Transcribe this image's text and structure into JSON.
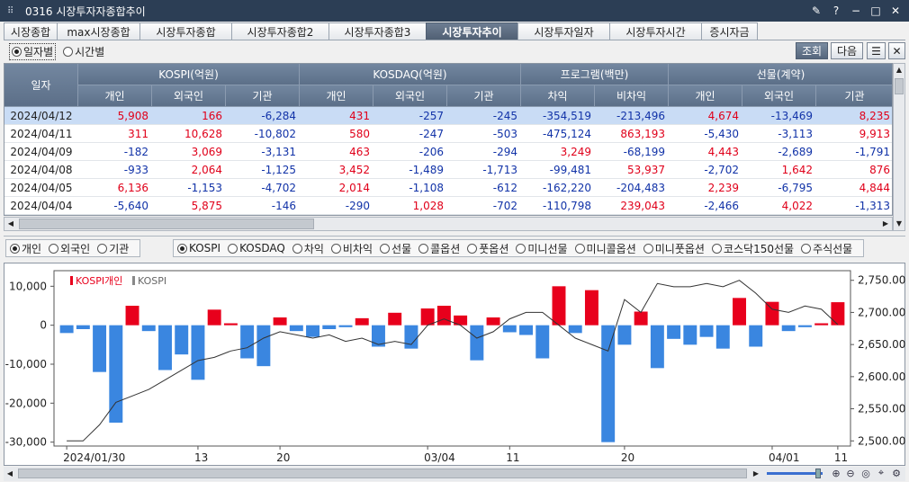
{
  "window": {
    "title": "0316 시장투자자종합추이"
  },
  "tabs": [
    "시장종합",
    "max시장종합",
    "시장투자종합",
    "시장투자종합2",
    "시장투자종합3",
    "시장투자추이",
    "시장투자일자",
    "시장투자시간",
    "증시자금"
  ],
  "active_tab": 5,
  "mode_options": {
    "by_date": "일자별",
    "by_time": "시간별"
  },
  "buttons": {
    "query": "조회",
    "next": "다음"
  },
  "table": {
    "date_header": "일자",
    "groups": [
      "KOSPI(억원)",
      "KOSDAQ(억원)",
      "프로그램(백만)",
      "선물(계약)"
    ],
    "subheaders": [
      "개인",
      "외국인",
      "기관",
      "개인",
      "외국인",
      "기관",
      "차익",
      "비차익",
      "개인",
      "외국인",
      "기관"
    ],
    "rows": [
      {
        "date": "2024/04/12",
        "vals": [
          "5,908",
          "166",
          "-6,284",
          "431",
          "-257",
          "-245",
          "-354,519",
          "-213,496",
          "4,674",
          "-13,469",
          "8,235"
        ]
      },
      {
        "date": "2024/04/11",
        "vals": [
          "311",
          "10,628",
          "-10,802",
          "580",
          "-247",
          "-503",
          "-475,124",
          "863,193",
          "-5,430",
          "-3,113",
          "9,913"
        ]
      },
      {
        "date": "2024/04/09",
        "vals": [
          "-182",
          "3,069",
          "-3,131",
          "463",
          "-206",
          "-294",
          "3,249",
          "-68,199",
          "4,443",
          "-2,689",
          "-1,791"
        ]
      },
      {
        "date": "2024/04/08",
        "vals": [
          "-933",
          "2,064",
          "-1,125",
          "3,452",
          "-1,489",
          "-1,713",
          "-99,481",
          "53,937",
          "-2,702",
          "1,642",
          "876"
        ]
      },
      {
        "date": "2024/04/05",
        "vals": [
          "6,136",
          "-1,153",
          "-4,702",
          "2,014",
          "-1,108",
          "-612",
          "-162,220",
          "-204,483",
          "2,239",
          "-6,795",
          "4,844"
        ]
      },
      {
        "date": "2024/04/04",
        "vals": [
          "-5,640",
          "5,875",
          "-146",
          "-290",
          "1,028",
          "-702",
          "-110,798",
          "239,043",
          "-2,466",
          "4,022",
          "-1,313"
        ]
      }
    ]
  },
  "investor_options": [
    "개인",
    "외국인",
    "기관"
  ],
  "market_options": [
    "KOSPI",
    "KOSDAQ",
    "차익",
    "비차익",
    "선물",
    "콜옵션",
    "풋옵션",
    "미니선물",
    "미니콜옵션",
    "미니풋옵션",
    "코스닥150선물",
    "주식선물"
  ],
  "chart_data": {
    "type": "bar",
    "legend": [
      "KOSPI개인",
      "KOSPI"
    ],
    "series": [
      {
        "name": "KOSPI개인",
        "values": [
          -2000,
          -1000,
          -12000,
          -25000,
          5000,
          -1500,
          -11500,
          -7500,
          -14000,
          4000,
          500,
          -8500,
          -10500,
          2000,
          -1500,
          -3000,
          -1000,
          -500,
          1800,
          -5500,
          3200,
          -6000,
          4300,
          5000,
          2500,
          -9000,
          2000,
          -1800,
          -2500,
          -8500,
          10000,
          -2000,
          9000,
          -30000,
          -5000,
          3500,
          -11000,
          -3500,
          -5000,
          -3000,
          -6000,
          7000,
          -5500,
          6000,
          -1500,
          -500,
          500,
          5908
        ]
      },
      {
        "name": "KOSPI",
        "values": [
          2500,
          2500,
          2525,
          2560,
          2570,
          2580,
          2595,
          2610,
          2625,
          2630,
          2640,
          2645,
          2660,
          2670,
          2665,
          2660,
          2665,
          2655,
          2660,
          2650,
          2655,
          2650,
          2680,
          2690,
          2680,
          2660,
          2670,
          2690,
          2700,
          2700,
          2680,
          2660,
          2650,
          2640,
          2720,
          2700,
          2745,
          2740,
          2740,
          2745,
          2740,
          2750,
          2730,
          2705,
          2700,
          2710,
          2705,
          2681
        ]
      }
    ],
    "y_left_ticks": [
      "10,000",
      "0",
      "-10,000",
      "-20,000",
      "-30,000"
    ],
    "y_left_range": [
      -31000,
      14000
    ],
    "y_right_ticks": [
      "2,750.00",
      "2,700.00",
      "2,650.00",
      "2,600.00",
      "2,550.00",
      "2,500.00"
    ],
    "y_right_range": [
      2492,
      2765
    ],
    "x_tick_labels": [
      {
        "label": "2024/01/30",
        "index": 0
      },
      {
        "label": "13",
        "index": 8
      },
      {
        "label": "20",
        "index": 13
      },
      {
        "label": "03/04",
        "index": 22
      },
      {
        "label": "11",
        "index": 27
      },
      {
        "label": "20",
        "index": 34
      },
      {
        "label": "04/01",
        "index": 43
      },
      {
        "label": "11",
        "index": 47
      }
    ],
    "colors": {
      "positive": "#e8001c",
      "negative": "#3a86e0",
      "line": "#333333"
    }
  }
}
